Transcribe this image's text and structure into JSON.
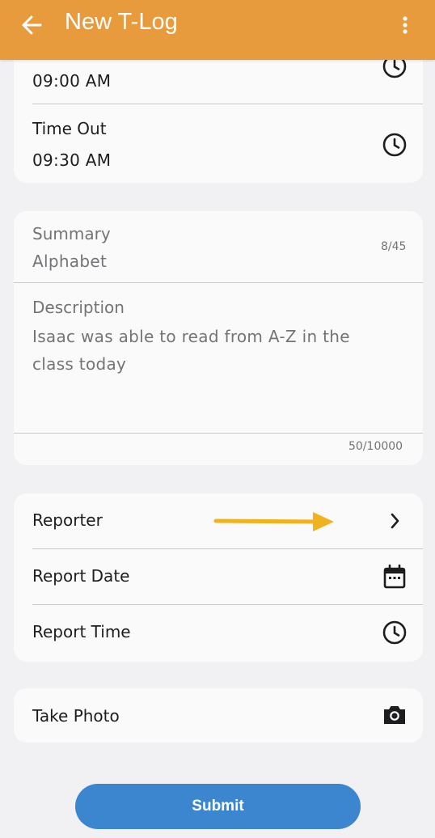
{
  "appbar": {
    "title": "New T-Log",
    "back_icon": "arrow-left-icon",
    "more_icon": "more-vertical-icon",
    "color": "#e89b3c"
  },
  "time_card": {
    "time_in_value": "09:00 AM",
    "time_out_label": "Time Out",
    "time_out_value": "09:30 AM",
    "icon": "clock-icon"
  },
  "summary_card": {
    "summary_label": "Summary",
    "summary_value": "Alphabet",
    "summary_counter": "8/45",
    "description_label": "Description",
    "description_value": "Isaac was able to read from A-Z in the class today",
    "description_counter": "50/10000"
  },
  "report_card": {
    "reporter_label": "Reporter",
    "report_date_label": "Report Date",
    "report_time_label": "Report Time",
    "annotation_color": "#f0b31e"
  },
  "photo_card": {
    "take_photo_label": "Take Photo",
    "icon": "camera-icon"
  },
  "submit": {
    "label": "Submit",
    "color": "#3c86cf"
  }
}
